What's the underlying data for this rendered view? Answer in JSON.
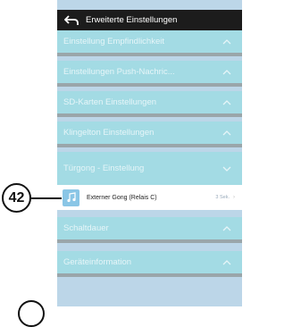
{
  "header": {
    "title": "Erweiterte Einstellungen",
    "back_icon": "back-arrow-icon"
  },
  "sections": [
    {
      "label": "Einstellung Empfindlichkeit",
      "chevron": "up"
    },
    {
      "label": "Einstellungen Push-Nachric...",
      "chevron": "up"
    },
    {
      "label": "SD-Karten Einstellungen",
      "chevron": "up"
    },
    {
      "label": "Klingelton Einstellungen",
      "chevron": "up"
    },
    {
      "label": "Türgong - Einstellung",
      "chevron": "down"
    },
    {
      "label": "Schaltdauer",
      "chevron": "up"
    },
    {
      "label": "Geräteinformation",
      "chevron": "up"
    }
  ],
  "expanded_item": {
    "label": "Externer Gong (Relais C)",
    "value": "3 Sek.",
    "icon": "music-note-icon"
  },
  "callout": {
    "number": "42"
  },
  "colors": {
    "header_bg": "#1c1c1c",
    "section_bg": "#a3dbe4",
    "phone_bg": "#bcd6e8",
    "separator": "#9aa6aa"
  }
}
